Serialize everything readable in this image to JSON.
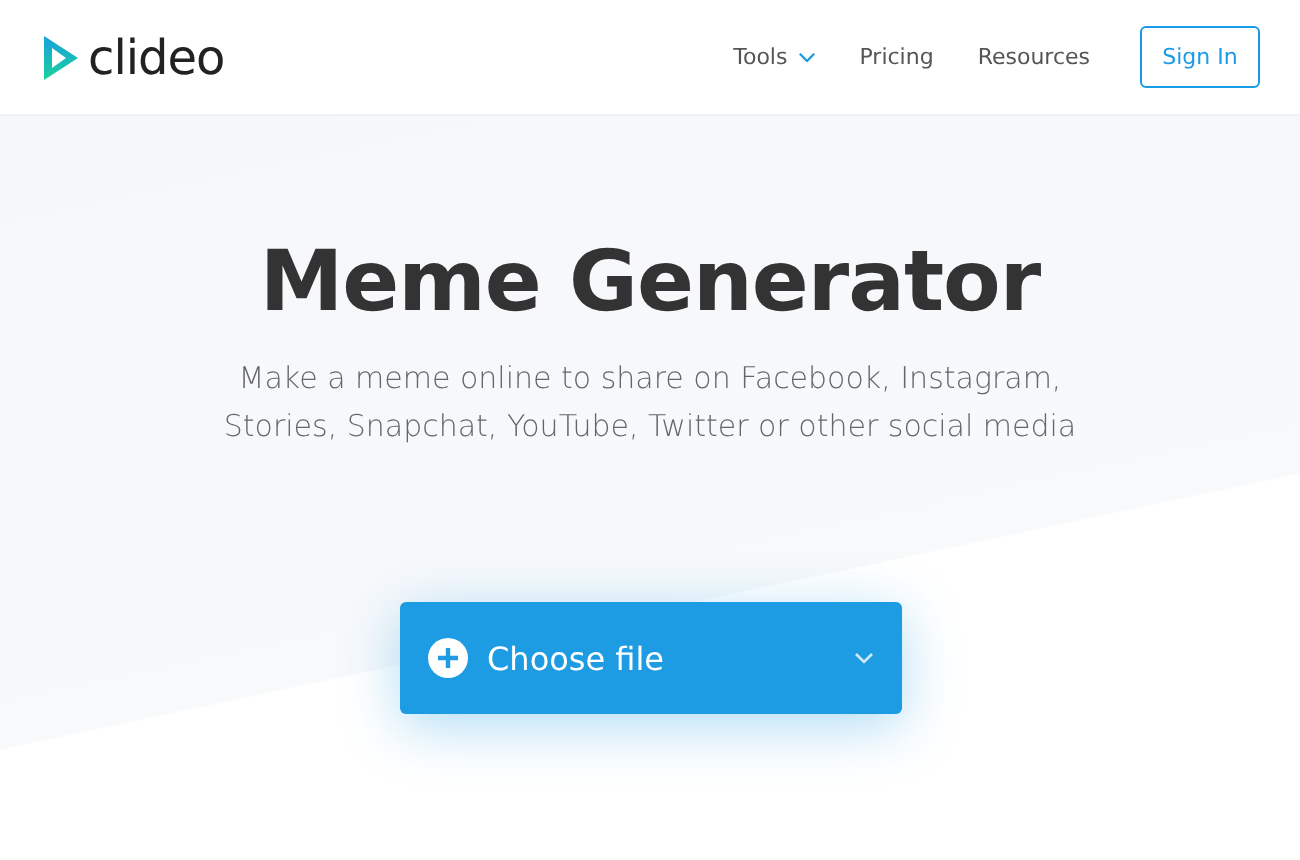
{
  "header": {
    "logo": "clideo",
    "nav": [
      {
        "label": "Tools",
        "dropdown": true
      },
      {
        "label": "Pricing",
        "dropdown": false
      },
      {
        "label": "Resources",
        "dropdown": false
      }
    ],
    "sign_in": "Sign In"
  },
  "hero": {
    "title": "Meme Generator",
    "subtitle": "Make a meme online to share on Facebook, Instagram, Stories, Snapchat, YouTube, Twitter or other social media",
    "upload_button": "Choose file"
  }
}
